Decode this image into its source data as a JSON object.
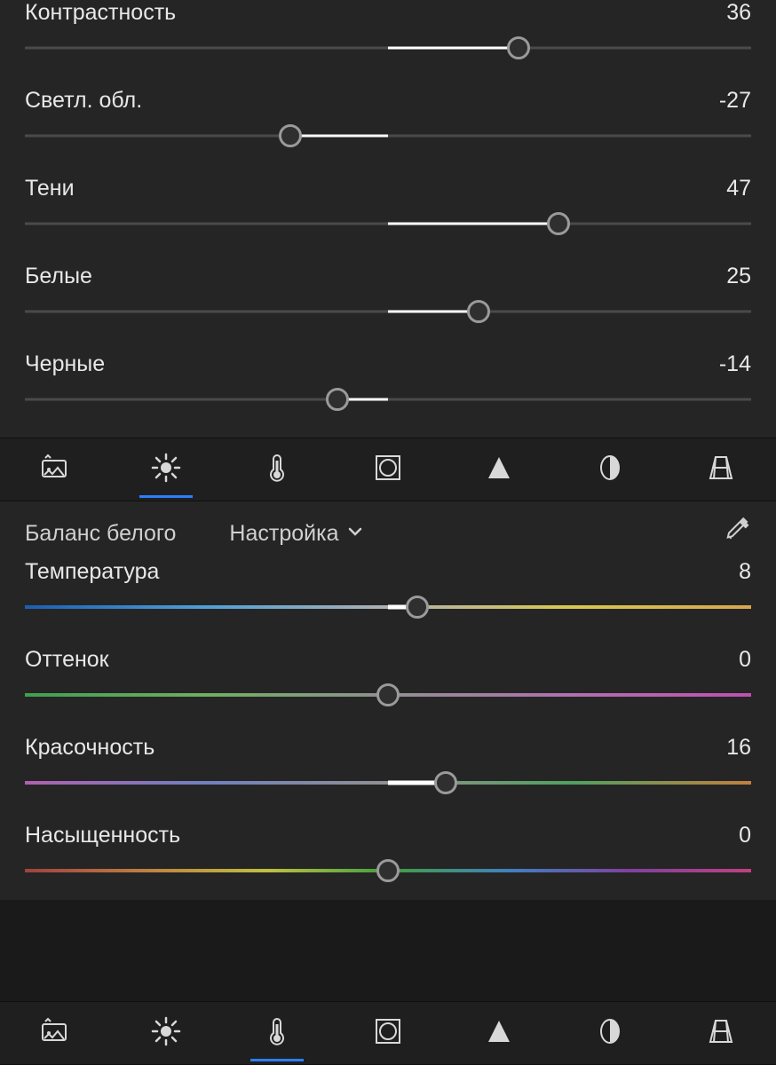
{
  "light": {
    "sliders": [
      {
        "label": "Контрастность",
        "value": 36,
        "min": -100,
        "max": 100
      },
      {
        "label": "Светл. обл.",
        "value": -27,
        "min": -100,
        "max": 100
      },
      {
        "label": "Тени",
        "value": 47,
        "min": -100,
        "max": 100
      },
      {
        "label": "Белые",
        "value": 25,
        "min": -100,
        "max": 100
      },
      {
        "label": "Черные",
        "value": -14,
        "min": -100,
        "max": 100
      }
    ]
  },
  "tabs": [
    {
      "name": "presets-tab",
      "icon": "presets-icon"
    },
    {
      "name": "light-tab",
      "icon": "sun-icon"
    },
    {
      "name": "color-tab",
      "icon": "thermometer-icon"
    },
    {
      "name": "effects-tab",
      "icon": "vignette-icon"
    },
    {
      "name": "detail-tab",
      "icon": "triangle-icon"
    },
    {
      "name": "optics-tab",
      "icon": "lens-icon"
    },
    {
      "name": "geometry-tab",
      "icon": "geometry-icon"
    }
  ],
  "active_tab_top": 1,
  "active_tab_bottom": 2,
  "color": {
    "section_title": "Баланс белого",
    "preset_label": "Настройка",
    "sliders": [
      {
        "label": "Температура",
        "value": 8,
        "min": -100,
        "max": 100,
        "gradient": "grad-temp"
      },
      {
        "label": "Оттенок",
        "value": 0,
        "min": -100,
        "max": 100,
        "gradient": "grad-tint"
      },
      {
        "label": "Красочность",
        "value": 16,
        "min": -100,
        "max": 100,
        "gradient": "grad-vib"
      },
      {
        "label": "Насыщенность",
        "value": 0,
        "min": -100,
        "max": 100,
        "gradient": "grad-sat"
      }
    ]
  }
}
